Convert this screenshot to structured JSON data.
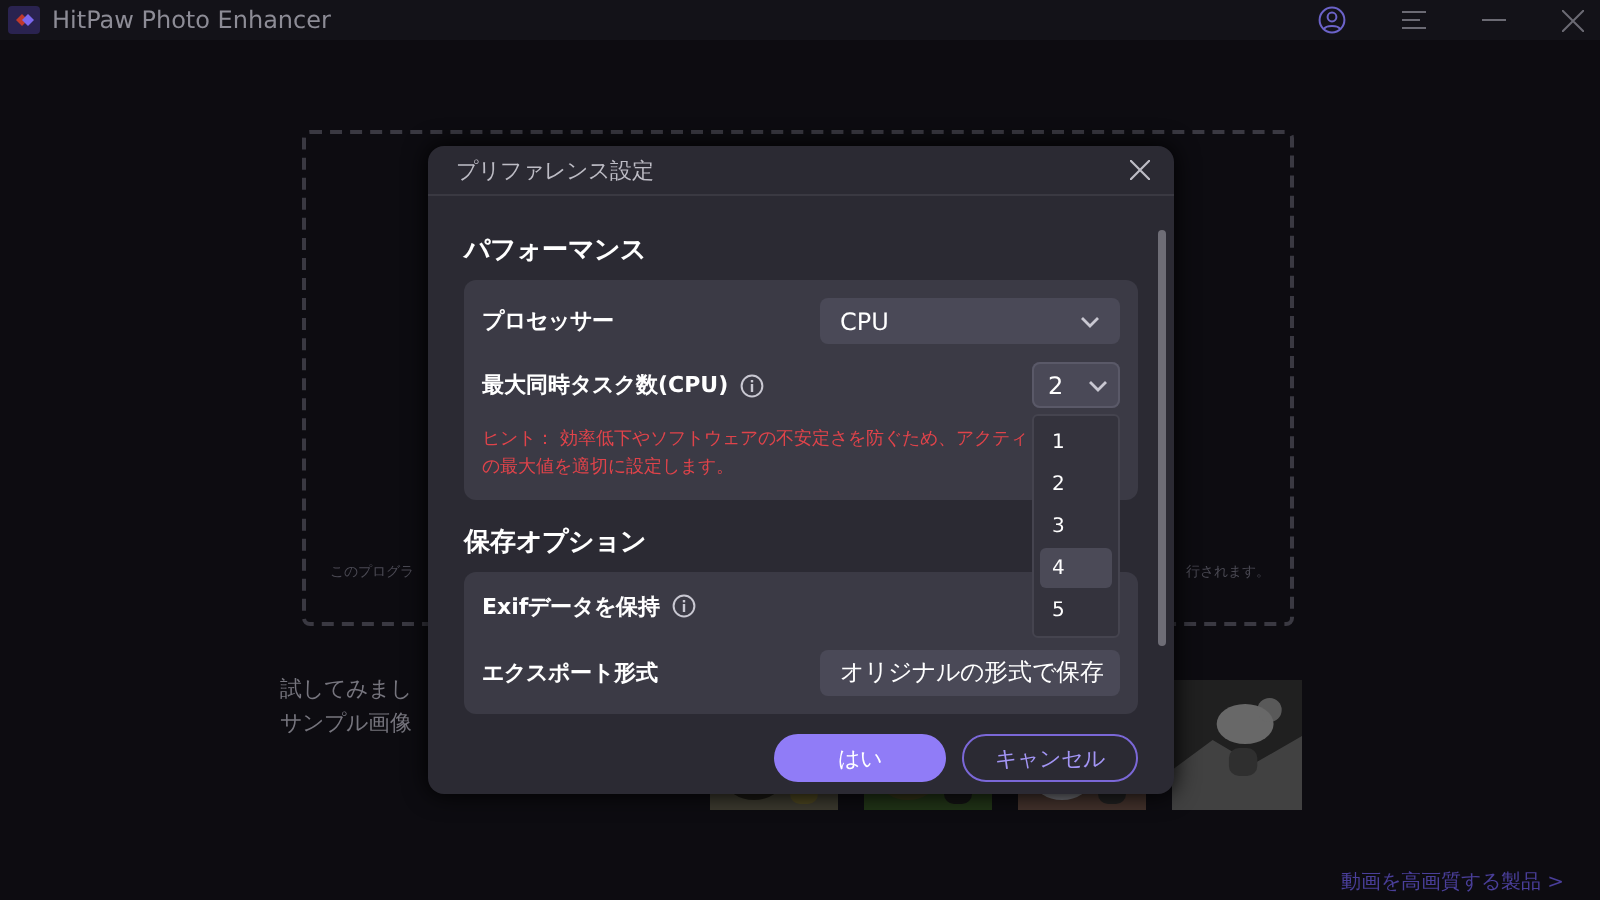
{
  "window": {
    "title": "HitPaw Photo Enhancer"
  },
  "workspace": {
    "drop_text_left": "このプログラ",
    "drop_text_right": "行されます。",
    "sample_lines": [
      "試してみまし",
      "サンプル画像"
    ],
    "samples": [
      {
        "kind": "picture"
      },
      {
        "kind": "picture"
      },
      {
        "kind": "picture"
      },
      {
        "kind": "picture"
      }
    ],
    "footer_link": "動画を高画質する製品 >"
  },
  "dialog": {
    "title": "プリファレンス設定",
    "sections": [
      {
        "heading": "パフォーマンス",
        "rows": [
          {
            "kind": "select",
            "label": "プロセッサー",
            "info": false,
            "value": "CPU",
            "compact": false,
            "expanded": false
          },
          {
            "kind": "select",
            "label": "最大同時タスク数(CPU)",
            "info": true,
            "value": "2",
            "compact": true,
            "expanded": true,
            "options": [
              {
                "label": "1",
                "highlighted": false
              },
              {
                "label": "2",
                "highlighted": false
              },
              {
                "label": "3",
                "highlighted": false
              },
              {
                "label": "4",
                "highlighted": true
              },
              {
                "label": "5",
                "highlighted": false
              }
            ]
          },
          {
            "kind": "hint",
            "lines": [
              "ヒント： 効率低下やソフトウェアの不安定さを防ぐため、アクティ",
              "の最大値を適切に設定します。"
            ]
          }
        ]
      },
      {
        "heading": "保存オプション",
        "rows": [
          {
            "kind": "label",
            "label": "Exifデータを保持",
            "info": true
          },
          {
            "kind": "select",
            "label": "エクスポート形式",
            "info": false,
            "value": "オリジナルの形式で保存",
            "compact": false,
            "expanded": false
          }
        ]
      }
    ],
    "buttons": [
      {
        "label": "はい",
        "kind": "primary"
      },
      {
        "label": "キャンセル",
        "kind": "secondary"
      }
    ]
  }
}
